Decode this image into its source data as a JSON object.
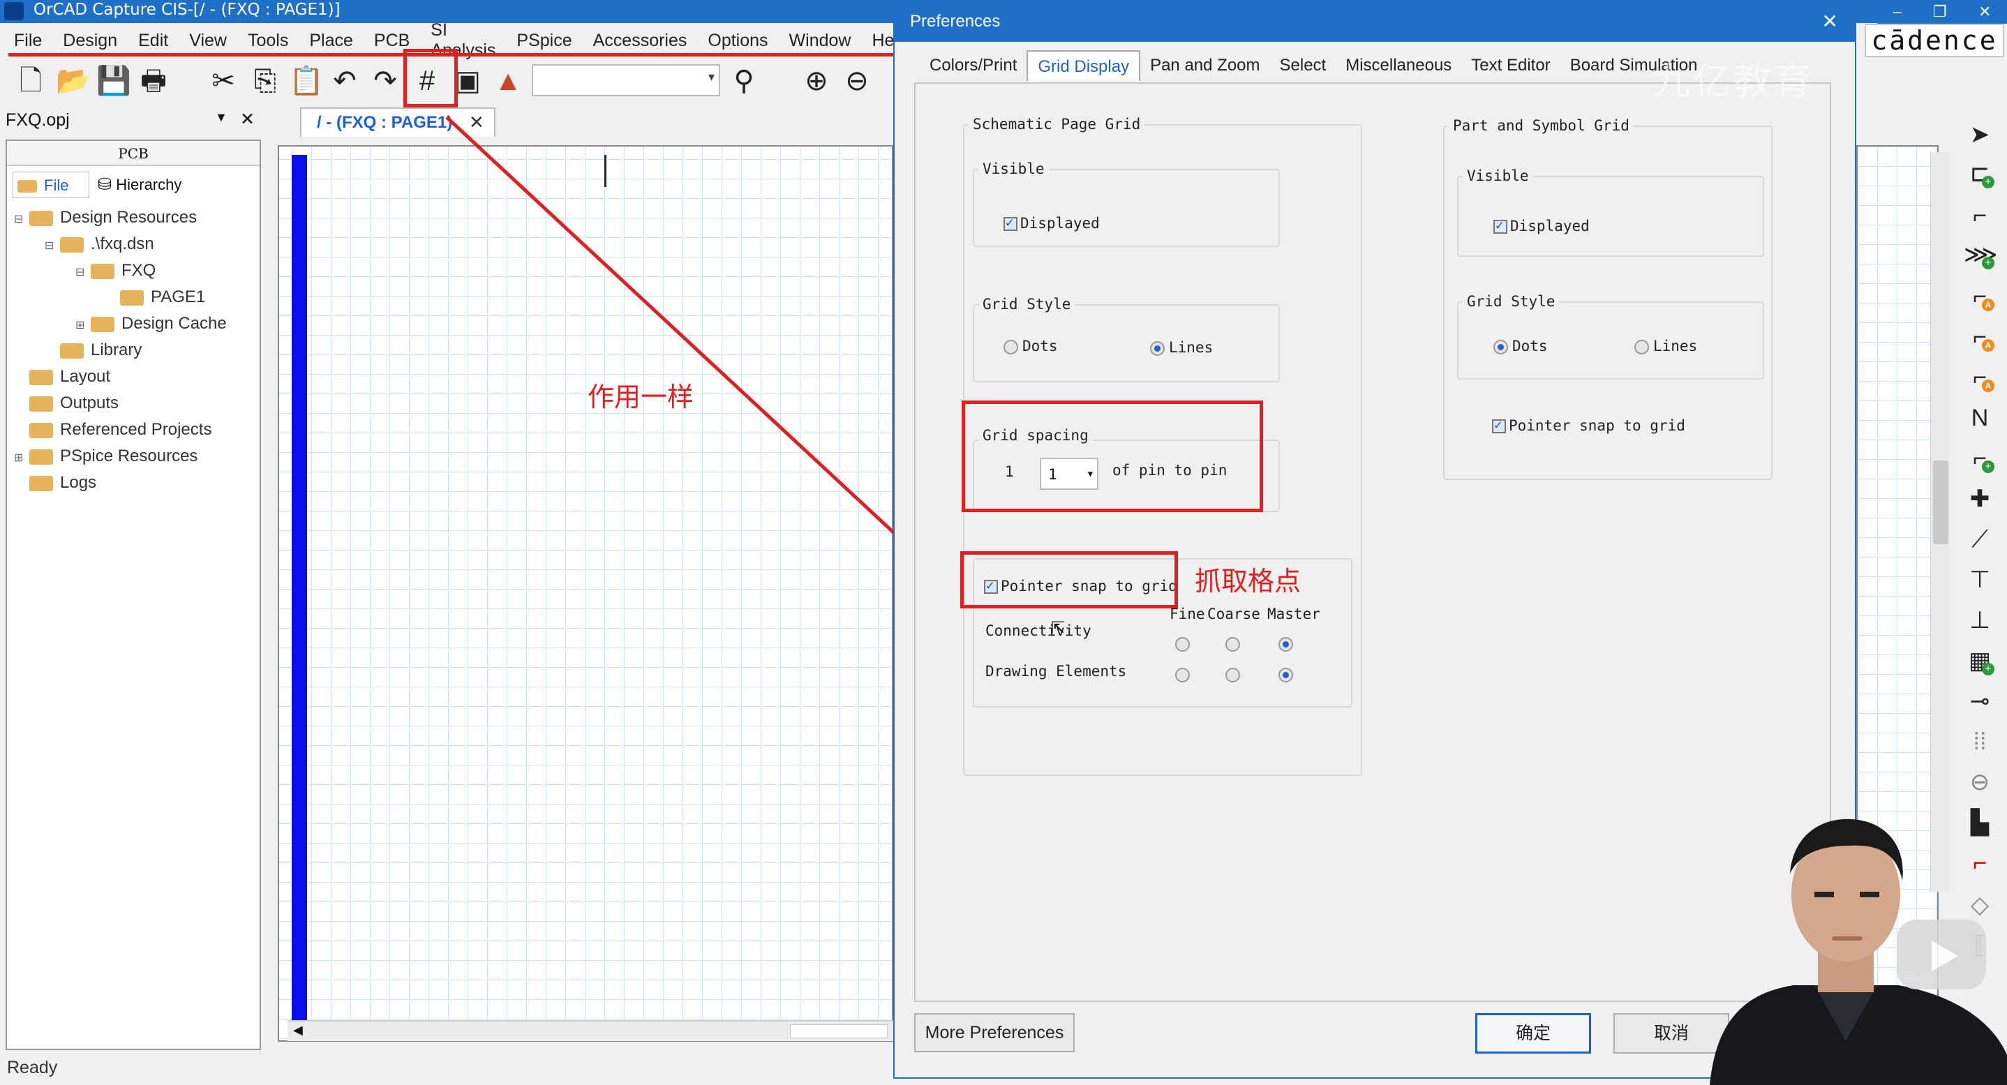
{
  "app": {
    "title": "OrCAD Capture CIS-[/ - (FXQ : PAGE1)]",
    "menu": [
      "File",
      "Design",
      "Edit",
      "View",
      "Tools",
      "Place",
      "PCB",
      "SI Analysis",
      "PSpice",
      "Accessories",
      "Options",
      "Window",
      "Help"
    ],
    "window_controls": [
      "–",
      "❐",
      "✕"
    ],
    "brand": "cādence"
  },
  "project": {
    "file": "FXQ.opj",
    "panel_header": "PCB",
    "tabs": [
      "File",
      "Hierarchy"
    ],
    "tree": [
      {
        "label": "Design Resources",
        "level": 0,
        "expander": "⊟"
      },
      {
        "label": ".\\fxq.dsn",
        "level": 1,
        "expander": "⊟"
      },
      {
        "label": "FXQ",
        "level": 2,
        "expander": "⊟"
      },
      {
        "label": "PAGE1",
        "level": 3,
        "expander": ""
      },
      {
        "label": "Design Cache",
        "level": 2,
        "expander": "⊞"
      },
      {
        "label": "Library",
        "level": 1,
        "expander": ""
      },
      {
        "label": "Layout",
        "level": 0,
        "expander": ""
      },
      {
        "label": "Outputs",
        "level": 0,
        "expander": ""
      },
      {
        "label": "Referenced Projects",
        "level": 0,
        "expander": ""
      },
      {
        "label": "PSpice Resources",
        "level": 0,
        "expander": "⊞"
      },
      {
        "label": "Logs",
        "level": 0,
        "expander": ""
      }
    ]
  },
  "document_tab": "/ - (FXQ : PAGE1)",
  "status": "Ready",
  "annotations": {
    "same_function": "作用一样",
    "snap_to_grid_points": "抓取格点"
  },
  "watermark": "九亿教育",
  "dialog": {
    "title": "Preferences",
    "tabs": [
      "Colors/Print",
      "Grid Display",
      "Pan and Zoom",
      "Select",
      "Miscellaneous",
      "Text Editor",
      "Board Simulation"
    ],
    "active_tab": "Grid Display",
    "schematic": {
      "title": "Schematic Page Grid",
      "visible_label": "Visible",
      "displayed": "Displayed",
      "grid_style_label": "Grid Style",
      "dots": "Dots",
      "lines": "Lines",
      "grid_spacing_label": "Grid spacing",
      "spacing_prefix": "1",
      "spacing_value": "1",
      "spacing_suffix": "of pin to pin",
      "pointer_snap": "Pointer snap to grid",
      "col_fine": "Fine",
      "col_coarse": "Coarse",
      "col_master": "Master",
      "row_connectivity": "Connectivity",
      "row_drawing": "Drawing Elements"
    },
    "part": {
      "title": "Part and Symbol Grid",
      "visible_label": "Visible",
      "displayed": "Displayed",
      "grid_style_label": "Grid Style",
      "dots": "Dots",
      "lines": "Lines",
      "pointer_snap": "Pointer snap to grid"
    },
    "buttons": {
      "more": "More Preferences",
      "ok": "确定",
      "cancel": "取消"
    }
  },
  "colors": {
    "accent": "#1e6fc5",
    "annotation": "#e02020",
    "grid": "#cfe3f5",
    "wire_bar": "#0a10ea"
  }
}
